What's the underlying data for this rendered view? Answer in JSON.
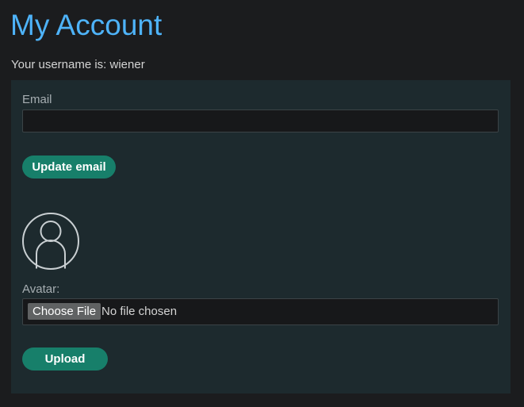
{
  "header": {
    "title": "My Account"
  },
  "account": {
    "username_line": "Your username is: wiener"
  },
  "email_form": {
    "label": "Email",
    "value": "",
    "placeholder": "",
    "submit_label": "Update email"
  },
  "avatar_form": {
    "avatar_icon": "user-silhouette-icon",
    "label": "Avatar:",
    "choose_label": "Choose File",
    "file_status": "No file chosen",
    "submit_label": "Upload"
  },
  "colors": {
    "page_background": "#1b1c1e",
    "panel_background": "#1d2a2e",
    "title": "#4eb3f9",
    "button": "#177f6a"
  }
}
